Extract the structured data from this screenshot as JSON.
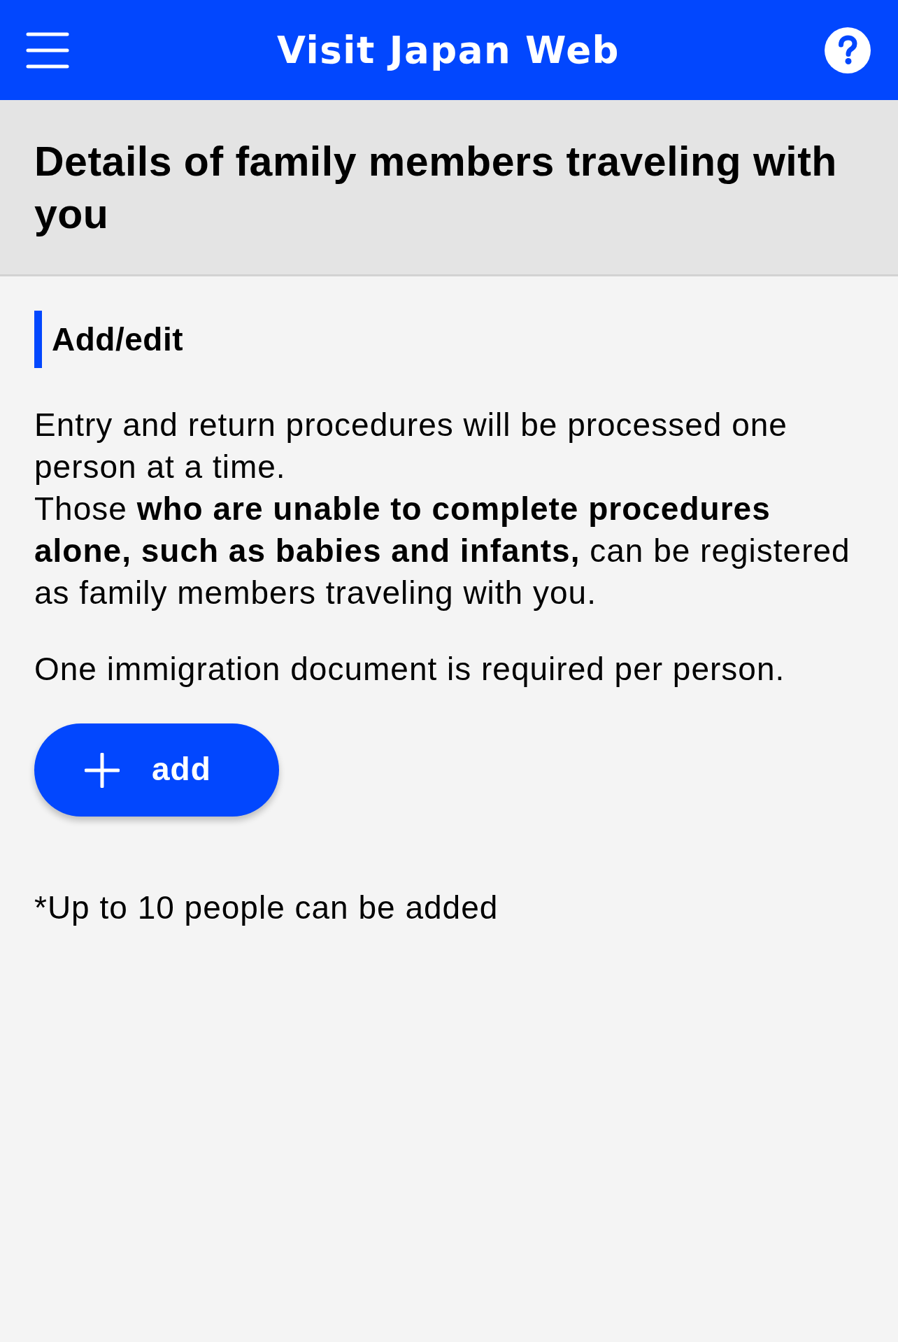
{
  "header": {
    "title": "Visit Japan Web"
  },
  "page_title": "Details of family members traveling with you",
  "section": {
    "heading": "Add/edit",
    "paragraphs": [
      {
        "lines": [
          "Entry and return procedures will be processed one person at a time.",
          "Those **who are unable to complete procedures alone, such as babies and infants,** can be registered as family members traveling with you."
        ]
      },
      {
        "lines": [
          "One immigration document is required per person."
        ]
      }
    ],
    "add_button": {
      "label": "add"
    },
    "note": "*Up to 10 people can be added"
  }
}
